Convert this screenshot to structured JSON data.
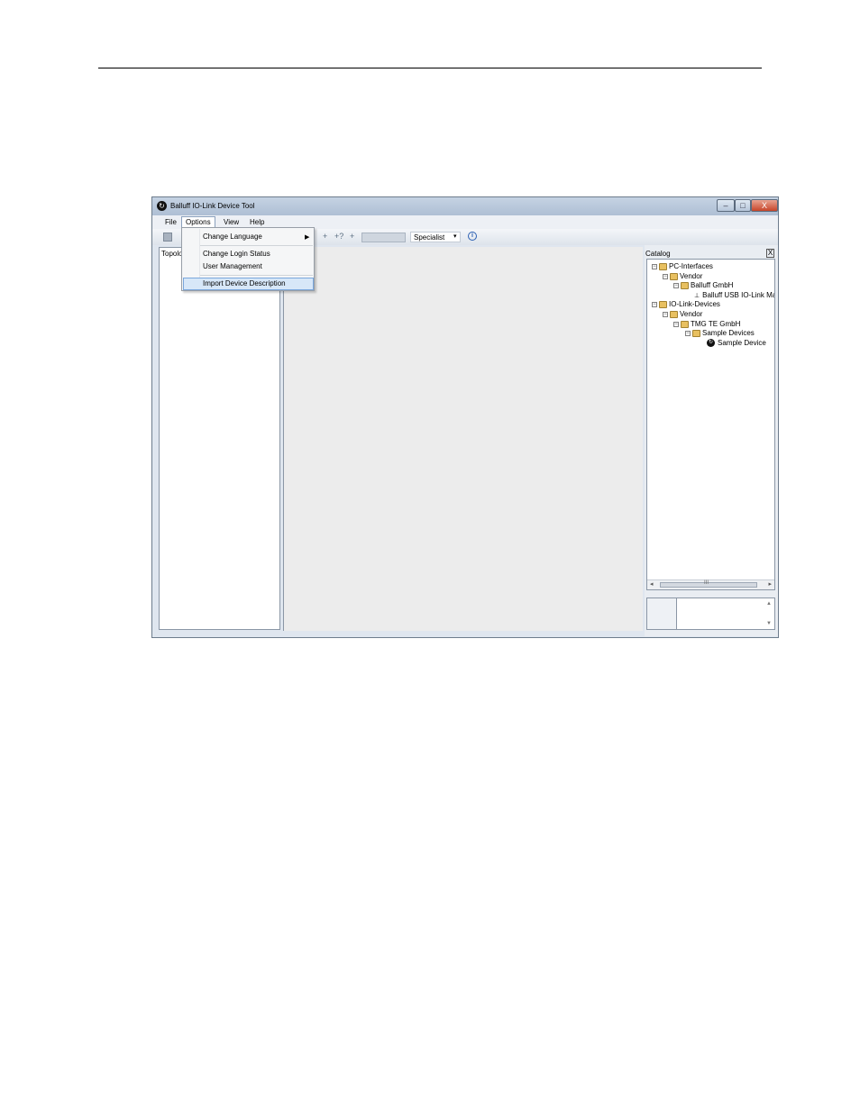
{
  "window": {
    "title": "Balluff IO-Link Device Tool",
    "controls": {
      "minimize": "–",
      "maximize": "□",
      "close": "X"
    }
  },
  "menubar": {
    "items": [
      "File",
      "Options",
      "View",
      "Help"
    ]
  },
  "options_menu": {
    "items": [
      "Change Language",
      "Change Login Status",
      "User Management",
      "Import Device Description"
    ],
    "highlighted": "Import Device Description"
  },
  "toolbar": {
    "role_select": "Specialist",
    "arrows": [
      "+",
      "+?",
      "+"
    ],
    "info_glyph": "i"
  },
  "topology": {
    "label": "Topolo"
  },
  "catalog": {
    "label": "Catalog",
    "close": "X",
    "tree": [
      {
        "label": "PC-Interfaces",
        "level": 0,
        "expander": "⊟"
      },
      {
        "label": "Vendor",
        "level": 1,
        "expander": "⊟"
      },
      {
        "label": "Balluff GmbH",
        "level": 2,
        "expander": "⊟"
      },
      {
        "label": "Balluff USB IO-Link Ma",
        "level": 3,
        "expander": ""
      },
      {
        "label": "IO-Link-Devices",
        "level": 0,
        "expander": "⊟"
      },
      {
        "label": "Vendor",
        "level": 1,
        "expander": "⊟"
      },
      {
        "label": "TMG TE GmbH",
        "level": 2,
        "expander": "⊟"
      },
      {
        "label": "Sample Devices",
        "level": 3,
        "expander": "⊟"
      },
      {
        "label": "Sample Device",
        "level": 4,
        "expander": ""
      }
    ],
    "scroll_thumb_glyph": "III"
  }
}
